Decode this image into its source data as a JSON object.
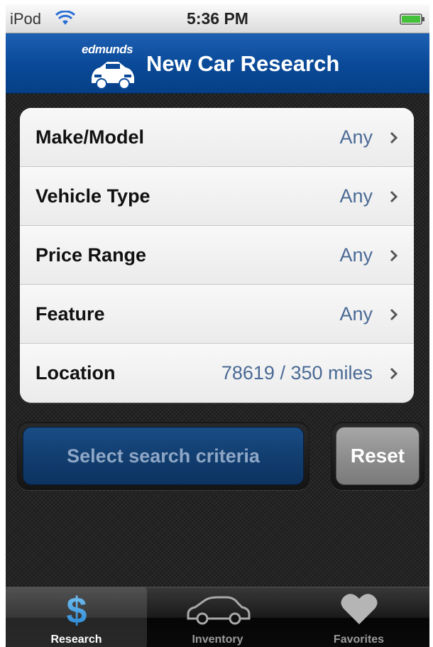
{
  "status_bar": {
    "carrier": "iPod",
    "time": "5:36 PM"
  },
  "nav": {
    "logo_text": "edmunds",
    "title": "New Car Research"
  },
  "criteria": [
    {
      "label": "Make/Model",
      "value": "Any"
    },
    {
      "label": "Vehicle Type",
      "value": "Any"
    },
    {
      "label": "Price Range",
      "value": "Any"
    },
    {
      "label": "Feature",
      "value": "Any"
    },
    {
      "label": "Location",
      "value": "78619 / 350 miles"
    }
  ],
  "buttons": {
    "search_label": "Select search criteria",
    "reset_label": "Reset"
  },
  "tabs": [
    {
      "label": "Research",
      "icon": "dollar-icon",
      "selected": true
    },
    {
      "label": "Inventory",
      "icon": "car-icon",
      "selected": false
    },
    {
      "label": "Favorites",
      "icon": "heart-icon",
      "selected": false
    }
  ],
  "colors": {
    "nav_blue": "#0a4a99",
    "value_blue": "#4a6a95",
    "selected_tab_icon": "#3fa6ea"
  }
}
